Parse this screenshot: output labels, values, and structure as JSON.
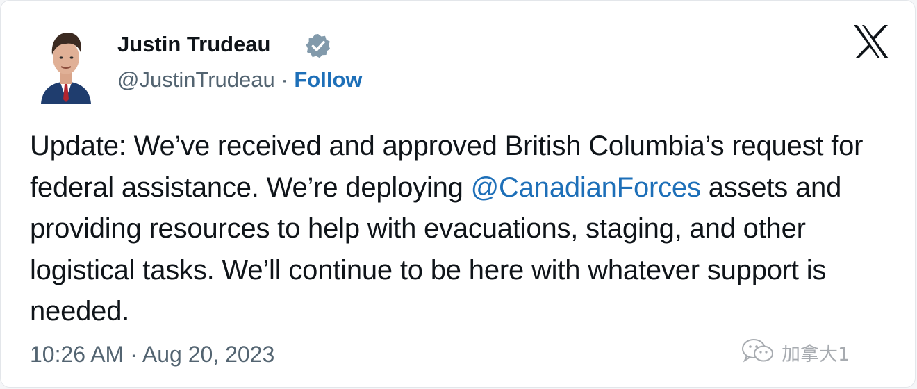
{
  "author": {
    "display_name": "Justin Trudeau",
    "handle": "@JustinTrudeau",
    "separator": "·",
    "follow_label": "Follow",
    "verified_icon": "verified-badge-icon"
  },
  "platform": {
    "logo_icon": "x-logo-icon"
  },
  "tweet": {
    "text_before_mention": "Update: We’ve received and approved British Columbia’s request for federal assistance. We’re deploying",
    "mention": "@CanadianForces",
    "text_after_mention": "assets and providing resources to help with evacuations, staging, and other logistical tasks. We’ll continue to be here with whatever support is needed."
  },
  "meta": {
    "time": "10:26 AM",
    "separator": "·",
    "date": "Aug 20, 2023"
  },
  "watermark": {
    "text": "加拿大1",
    "icon": "wechat-icon"
  },
  "colors": {
    "link": "#1d6fb8",
    "text": "#0f1419",
    "secondary": "#536471",
    "badge": "#829aab"
  }
}
